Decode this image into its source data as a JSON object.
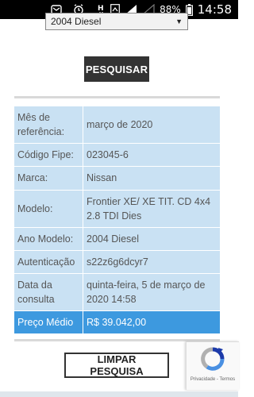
{
  "status_bar": {
    "time": "14:58",
    "battery_percent": "88%",
    "net_type": "H",
    "icons": [
      "notification-icon",
      "alarm-icon",
      "network-h-icon",
      "wifi-calling-icon",
      "signal-icon",
      "signal-empty-icon",
      "battery-icon"
    ]
  },
  "select": {
    "value": "2004 Diesel"
  },
  "buttons": {
    "search_label": "PESQUISAR",
    "clear_label": "LIMPAR PESQUISA"
  },
  "result": {
    "rows": [
      {
        "label": "Mês de referência:",
        "value": "março de 2020"
      },
      {
        "label": "Código Fipe:",
        "value": "023045-6"
      },
      {
        "label": "Marca:",
        "value": "Nissan"
      },
      {
        "label": "Modelo:",
        "value": "Frontier XE/ XE TIT. CD 4x4 2.8 TDI Dies"
      },
      {
        "label": "Ano Modelo:",
        "value": "2004 Diesel"
      },
      {
        "label": "Autenticação",
        "value": "s22z6g6dcyr7"
      },
      {
        "label": "Data da consulta",
        "value": "quinta-feira, 5 de março de 2020 14:58"
      }
    ],
    "price_label": "Preço Médio",
    "price_value": "R$ 39.042,00"
  },
  "recaptcha": {
    "links": "Privacidade - Termos"
  },
  "colors": {
    "table_bg": "#c9e1f3",
    "highlight_bg": "#3d99df",
    "button_dark": "#333333"
  }
}
